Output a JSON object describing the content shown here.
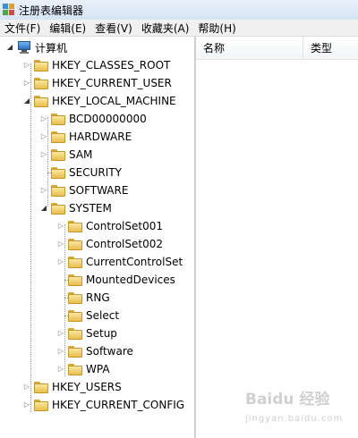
{
  "window": {
    "title": "注册表编辑器"
  },
  "menu": [
    "文件(F)",
    "编辑(E)",
    "查看(V)",
    "收藏夹(A)",
    "帮助(H)"
  ],
  "list": {
    "columns": [
      "名称",
      "类型"
    ]
  },
  "tree": [
    {
      "label": "计算机",
      "icon": "computer-icon",
      "expanded": true
    },
    {
      "label": "HKEY_CLASSES_ROOT",
      "icon": "folder-icon",
      "expanded": false
    },
    {
      "label": "HKEY_CURRENT_USER",
      "icon": "folder-icon",
      "expanded": false
    },
    {
      "label": "HKEY_LOCAL_MACHINE",
      "icon": "folder-icon",
      "expanded": true
    },
    {
      "label": "BCD00000000",
      "icon": "folder-icon",
      "expanded": false
    },
    {
      "label": "HARDWARE",
      "icon": "folder-icon",
      "expanded": false
    },
    {
      "label": "SAM",
      "icon": "folder-icon",
      "expanded": false
    },
    {
      "label": "SECURITY",
      "icon": "folder-icon",
      "expanded": false
    },
    {
      "label": "SOFTWARE",
      "icon": "folder-icon",
      "expanded": false
    },
    {
      "label": "SYSTEM",
      "icon": "folder-icon",
      "expanded": true
    },
    {
      "label": "ControlSet001",
      "icon": "folder-icon",
      "expanded": false
    },
    {
      "label": "ControlSet002",
      "icon": "folder-icon",
      "expanded": false
    },
    {
      "label": "CurrentControlSet",
      "icon": "folder-icon",
      "expanded": false
    },
    {
      "label": "MountedDevices",
      "icon": "folder-icon",
      "expanded": false
    },
    {
      "label": "RNG",
      "icon": "folder-icon",
      "expanded": false
    },
    {
      "label": "Select",
      "icon": "folder-icon",
      "expanded": false
    },
    {
      "label": "Setup",
      "icon": "folder-icon",
      "expanded": false
    },
    {
      "label": "Software",
      "icon": "folder-icon",
      "expanded": false
    },
    {
      "label": "WPA",
      "icon": "folder-icon",
      "expanded": false
    },
    {
      "label": "HKEY_USERS",
      "icon": "folder-icon",
      "expanded": false
    },
    {
      "label": "HKEY_CURRENT_CONFIG",
      "icon": "folder-icon",
      "expanded": false
    }
  ],
  "watermark": {
    "brand": "Baidu 经验",
    "site": "jingyan.baidu.com"
  }
}
